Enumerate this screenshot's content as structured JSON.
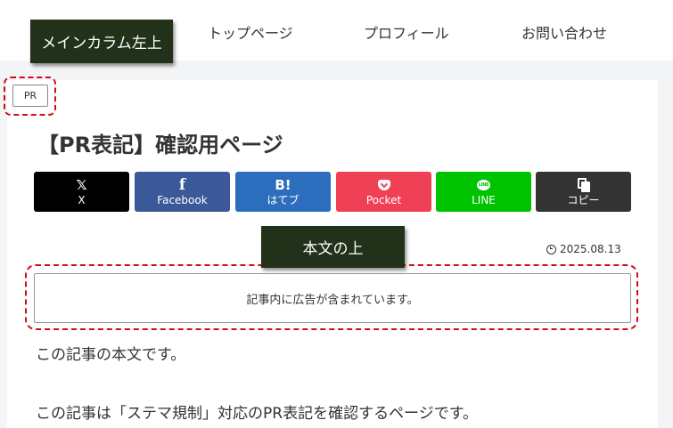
{
  "nav": {
    "items": [
      "トップページ",
      "プロフィール",
      "お問い合わせ"
    ]
  },
  "area_labels": {
    "main_left": "メインカラム左上",
    "body_top": "本文の上"
  },
  "article": {
    "pr_badge": "PR",
    "title": "【PR表記】確認用ページ",
    "date": "2025.08.13",
    "ad_notice": "記事内に広告が含まれています。",
    "paragraphs": [
      "この記事の本文です。",
      "この記事は「ステマ規制」対応のPR表記を確認するページです。"
    ]
  },
  "share_buttons": [
    {
      "label": "X",
      "icon": "x-logo-icon",
      "color": "#000000"
    },
    {
      "label": "Facebook",
      "icon": "facebook-icon",
      "color": "#3b5998"
    },
    {
      "label": "はてブ",
      "icon": "hatena-bookmark-icon",
      "icon_text": "B!",
      "color": "#2c6ebd"
    },
    {
      "label": "Pocket",
      "icon": "pocket-icon",
      "color": "#ef4056"
    },
    {
      "label": "LINE",
      "icon": "line-icon",
      "icon_text": "LINE",
      "color": "#00c300"
    },
    {
      "label": "コピー",
      "icon": "copy-icon",
      "color": "#333333"
    }
  ],
  "colors": {
    "area_label_bg": "#21311a",
    "dashed_highlight": "#d10a18",
    "page_background": "#f3f4f5"
  }
}
